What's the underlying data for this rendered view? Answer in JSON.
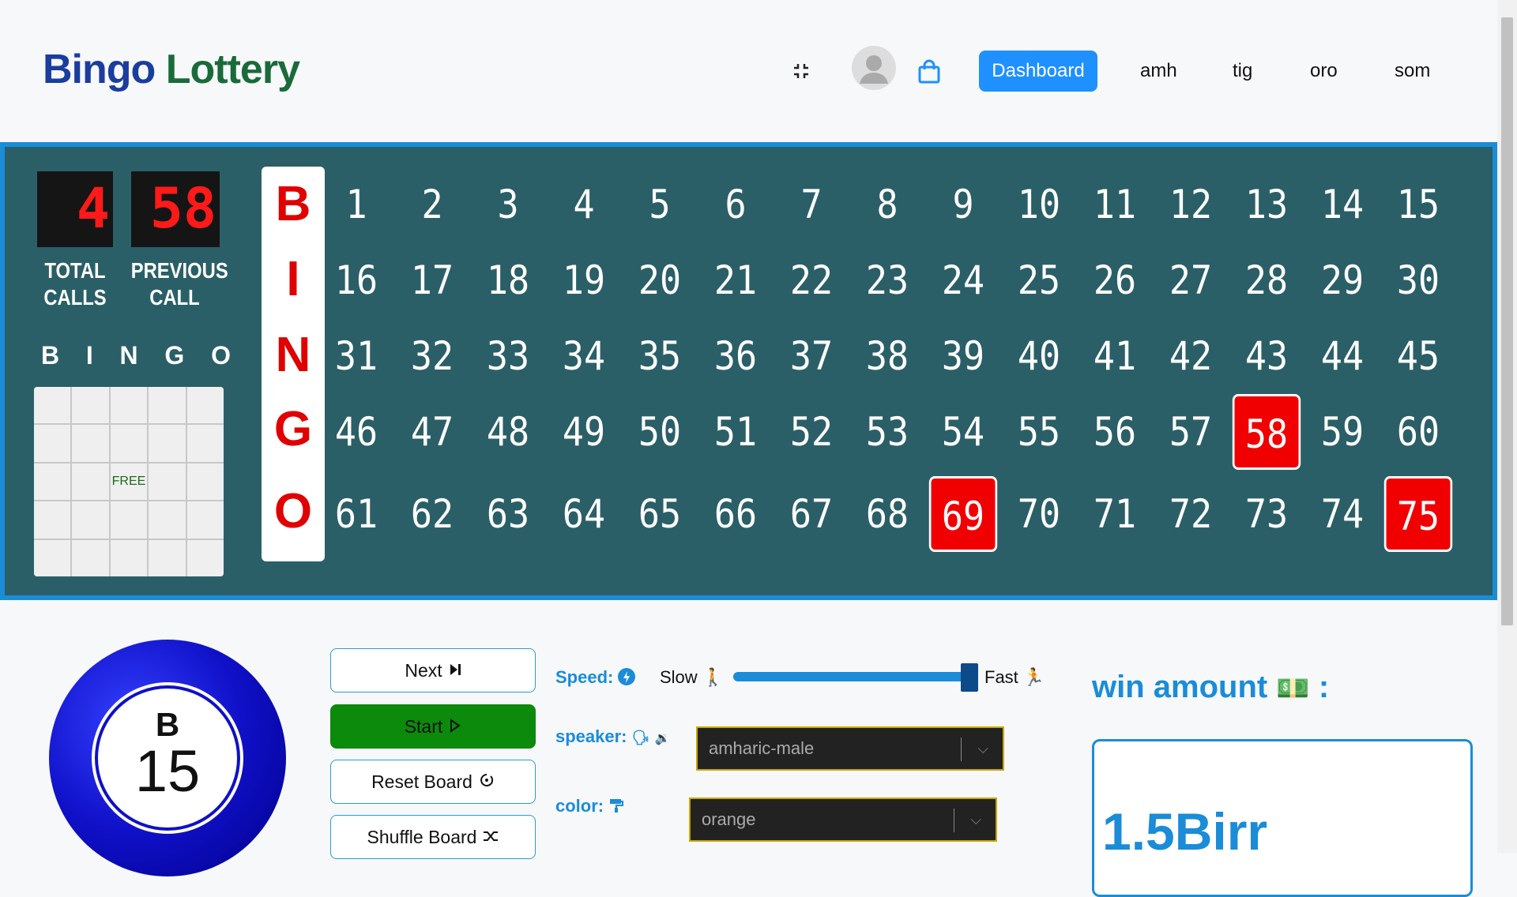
{
  "header": {
    "brand_part1": "Bingo",
    "brand_part2": "Lottery",
    "dashboard_label": "Dashboard",
    "languages": [
      "amh",
      "tig",
      "oro",
      "som"
    ]
  },
  "board": {
    "total_calls": "4",
    "previous_call": "58",
    "total_calls_label": [
      "TOTAL",
      "CALLS"
    ],
    "previous_call_label": [
      "PREVIOUS",
      "CALL"
    ],
    "letters": [
      "B",
      "I",
      "N",
      "G",
      "O"
    ],
    "mini_letters": [
      "B",
      "I",
      "N",
      "G",
      "O"
    ],
    "free_label": "FREE",
    "rows": [
      [
        "1",
        "2",
        "3",
        "4",
        "5",
        "6",
        "7",
        "8",
        "9",
        "10",
        "11",
        "12",
        "13",
        "14",
        "15"
      ],
      [
        "16",
        "17",
        "18",
        "19",
        "20",
        "21",
        "22",
        "23",
        "24",
        "25",
        "26",
        "27",
        "28",
        "29",
        "30"
      ],
      [
        "31",
        "32",
        "33",
        "34",
        "35",
        "36",
        "37",
        "38",
        "39",
        "40",
        "41",
        "42",
        "43",
        "44",
        "45"
      ],
      [
        "46",
        "47",
        "48",
        "49",
        "50",
        "51",
        "52",
        "53",
        "54",
        "55",
        "56",
        "57",
        "58",
        "59",
        "60"
      ],
      [
        "61",
        "62",
        "63",
        "64",
        "65",
        "66",
        "67",
        "68",
        "69",
        "70",
        "71",
        "72",
        "73",
        "74",
        "75"
      ]
    ],
    "called": [
      "58",
      "69",
      "75"
    ]
  },
  "ball": {
    "letter": "B",
    "number": "15"
  },
  "controls": {
    "next": "Next",
    "start": "Start",
    "reset": "Reset Board",
    "shuffle": "Shuffle Board"
  },
  "settings": {
    "speed_label": "Speed:",
    "slow": "Slow",
    "fast": "Fast",
    "speed_level": 1.0,
    "speaker_label": "speaker:",
    "speaker_value": "amharic-male",
    "color_label": "color:",
    "color_value": "orange"
  },
  "win": {
    "title": "win amount",
    "colon": ":",
    "value": "1.5Birr"
  },
  "colors": {
    "board_bg": "#2b5f68",
    "accent": "#1a8cd8",
    "called": "#f00000",
    "start": "#0b8a0b"
  }
}
